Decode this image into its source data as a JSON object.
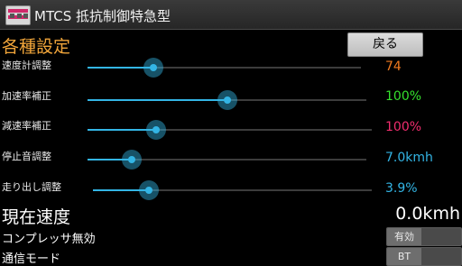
{
  "app": {
    "title": "MTCS 抵抗制御特急型",
    "icon": "train-icon"
  },
  "settings": {
    "title": "各種設定",
    "back_label": "戻る",
    "rows": [
      {
        "label": "速度計調整",
        "value": "74",
        "level": 0.24,
        "color": "#f07a1f"
      },
      {
        "label": "加速率補正",
        "value": "100%",
        "level": 0.5,
        "color": "#35e02d"
      },
      {
        "label": "減速率補正",
        "value": "100%",
        "level": 0.24,
        "color": "#f02d6e"
      },
      {
        "label": "停止音調整",
        "value": "7.0kmh",
        "level": 0.16,
        "color": "#33b5e5"
      },
      {
        "label": "走り出し調整",
        "value": "3.9%",
        "level": 0.2,
        "color": "#33b5e5"
      }
    ]
  },
  "status": {
    "speed_label": "現在速度",
    "speed_value": "0.0kmh",
    "compressor_label": "コンプレッサ無効",
    "compressor_button": "有効",
    "comm_label": "通信モード",
    "comm_button": "BT"
  }
}
